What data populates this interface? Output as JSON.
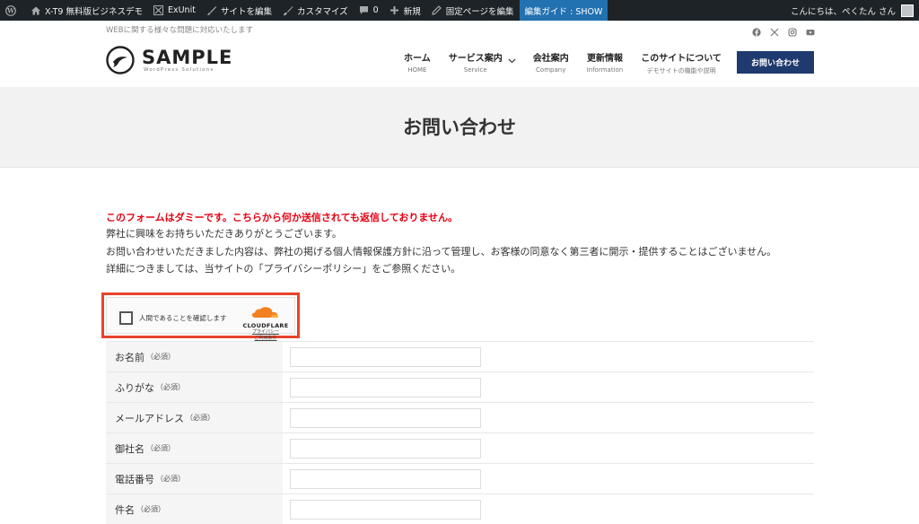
{
  "adminbar": {
    "site_name": "X-T9 無料版ビジネスデモ",
    "exunit": "ExUnit",
    "edit_site": "サイトを編集",
    "customize": "カスタマイズ",
    "comments_count": "0",
    "new": "新規",
    "edit_page": "固定ページを編集",
    "edit_guide": "編集ガイド : SHOW",
    "greeting": "こんにちは、ぺくたん さん"
  },
  "header": {
    "tagline": "WEBに関する様々な問題に対応いたします",
    "logo_main": "SAMPLE",
    "logo_sub": "WordPress Solutions",
    "nav": [
      {
        "label": "ホーム",
        "sub": "HOME"
      },
      {
        "label": "サービス案内",
        "sub": "Service"
      },
      {
        "label": "会社案内",
        "sub": "Company"
      },
      {
        "label": "更新情報",
        "sub": "Information"
      },
      {
        "label": "このサイトについて",
        "sub": "デモサイトの機能や説明"
      }
    ],
    "contact_button": "お問い合わせ"
  },
  "page": {
    "title": "お問い合わせ"
  },
  "content": {
    "notice": "このフォームはダミーです。こちらから何か送信されても返信しておりません。",
    "line1": "弊社に興味をお持ちいただきありがとうございます。",
    "line2": "お問い合わせいただきました内容は、弊社の掲げる個人情報保護方針に沿って管理し、お客様の同意なく第三者に開示・提供することはございません。",
    "line3": "詳細につきましては、当サイトの「プライバシーポリシー」をご参照ください。"
  },
  "captcha": {
    "label": "人間であることを確認します",
    "brand": "CLOUDFLARE",
    "privacy_link": "プライバシー",
    "terms_link": "ご利用条件"
  },
  "form": {
    "rows": [
      {
        "label": "お名前",
        "note": "（必須）"
      },
      {
        "label": "ふりがな",
        "note": "（必須）"
      },
      {
        "label": "メールアドレス",
        "note": "（必須）"
      },
      {
        "label": "御社名",
        "note": "（必須）"
      },
      {
        "label": "電話番号",
        "note": "（必須）"
      },
      {
        "label": "件名",
        "note": "（必須）"
      }
    ]
  },
  "colors": {
    "adminbar_bg": "#1d2327",
    "accent_blue": "#2271b1",
    "contact_btn": "#1e3a6e",
    "notice_red": "#e60012",
    "highlight_border": "#e8432c",
    "cloudflare_orange": "#f38020"
  }
}
